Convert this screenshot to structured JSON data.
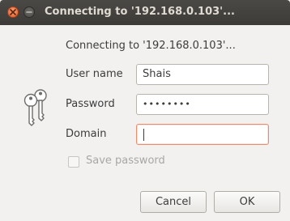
{
  "window": {
    "title": "Connecting to '192.168.0.103'..."
  },
  "dialog": {
    "heading": "Connecting to '192.168.0.103'...",
    "icon": "keys-icon",
    "fields": {
      "username": {
        "label": "User name",
        "value": "Shais"
      },
      "password": {
        "label": "Password",
        "value": "••••••••"
      },
      "domain": {
        "label": "Domain",
        "value": ""
      }
    },
    "save_password": {
      "label": "Save password",
      "checked": false,
      "enabled": false
    },
    "buttons": {
      "cancel": "Cancel",
      "ok": "OK"
    }
  },
  "colors": {
    "titlebar": "#3c3b37",
    "close_button": "#e2582a",
    "focus_border": "#e98e6c"
  }
}
